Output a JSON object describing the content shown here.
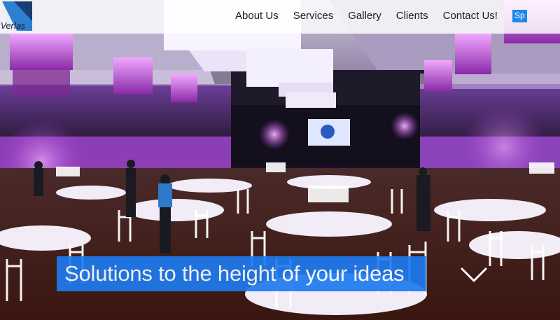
{
  "brand": {
    "wordmark": "Verlas"
  },
  "nav": {
    "items": [
      {
        "label": "About Us"
      },
      {
        "label": "Services"
      },
      {
        "label": "Gallery"
      },
      {
        "label": "Clients"
      },
      {
        "label": "Contact Us!"
      }
    ],
    "language_badge": "Sp"
  },
  "hero": {
    "tagline": "Solutions to the height of your ideas",
    "scroll_icon": "chevron-down-icon"
  },
  "colors": {
    "accent": "#1e7bf0",
    "badge": "#1e88e5",
    "header_bg": "#ffffff",
    "lighting": "#c64df0"
  }
}
